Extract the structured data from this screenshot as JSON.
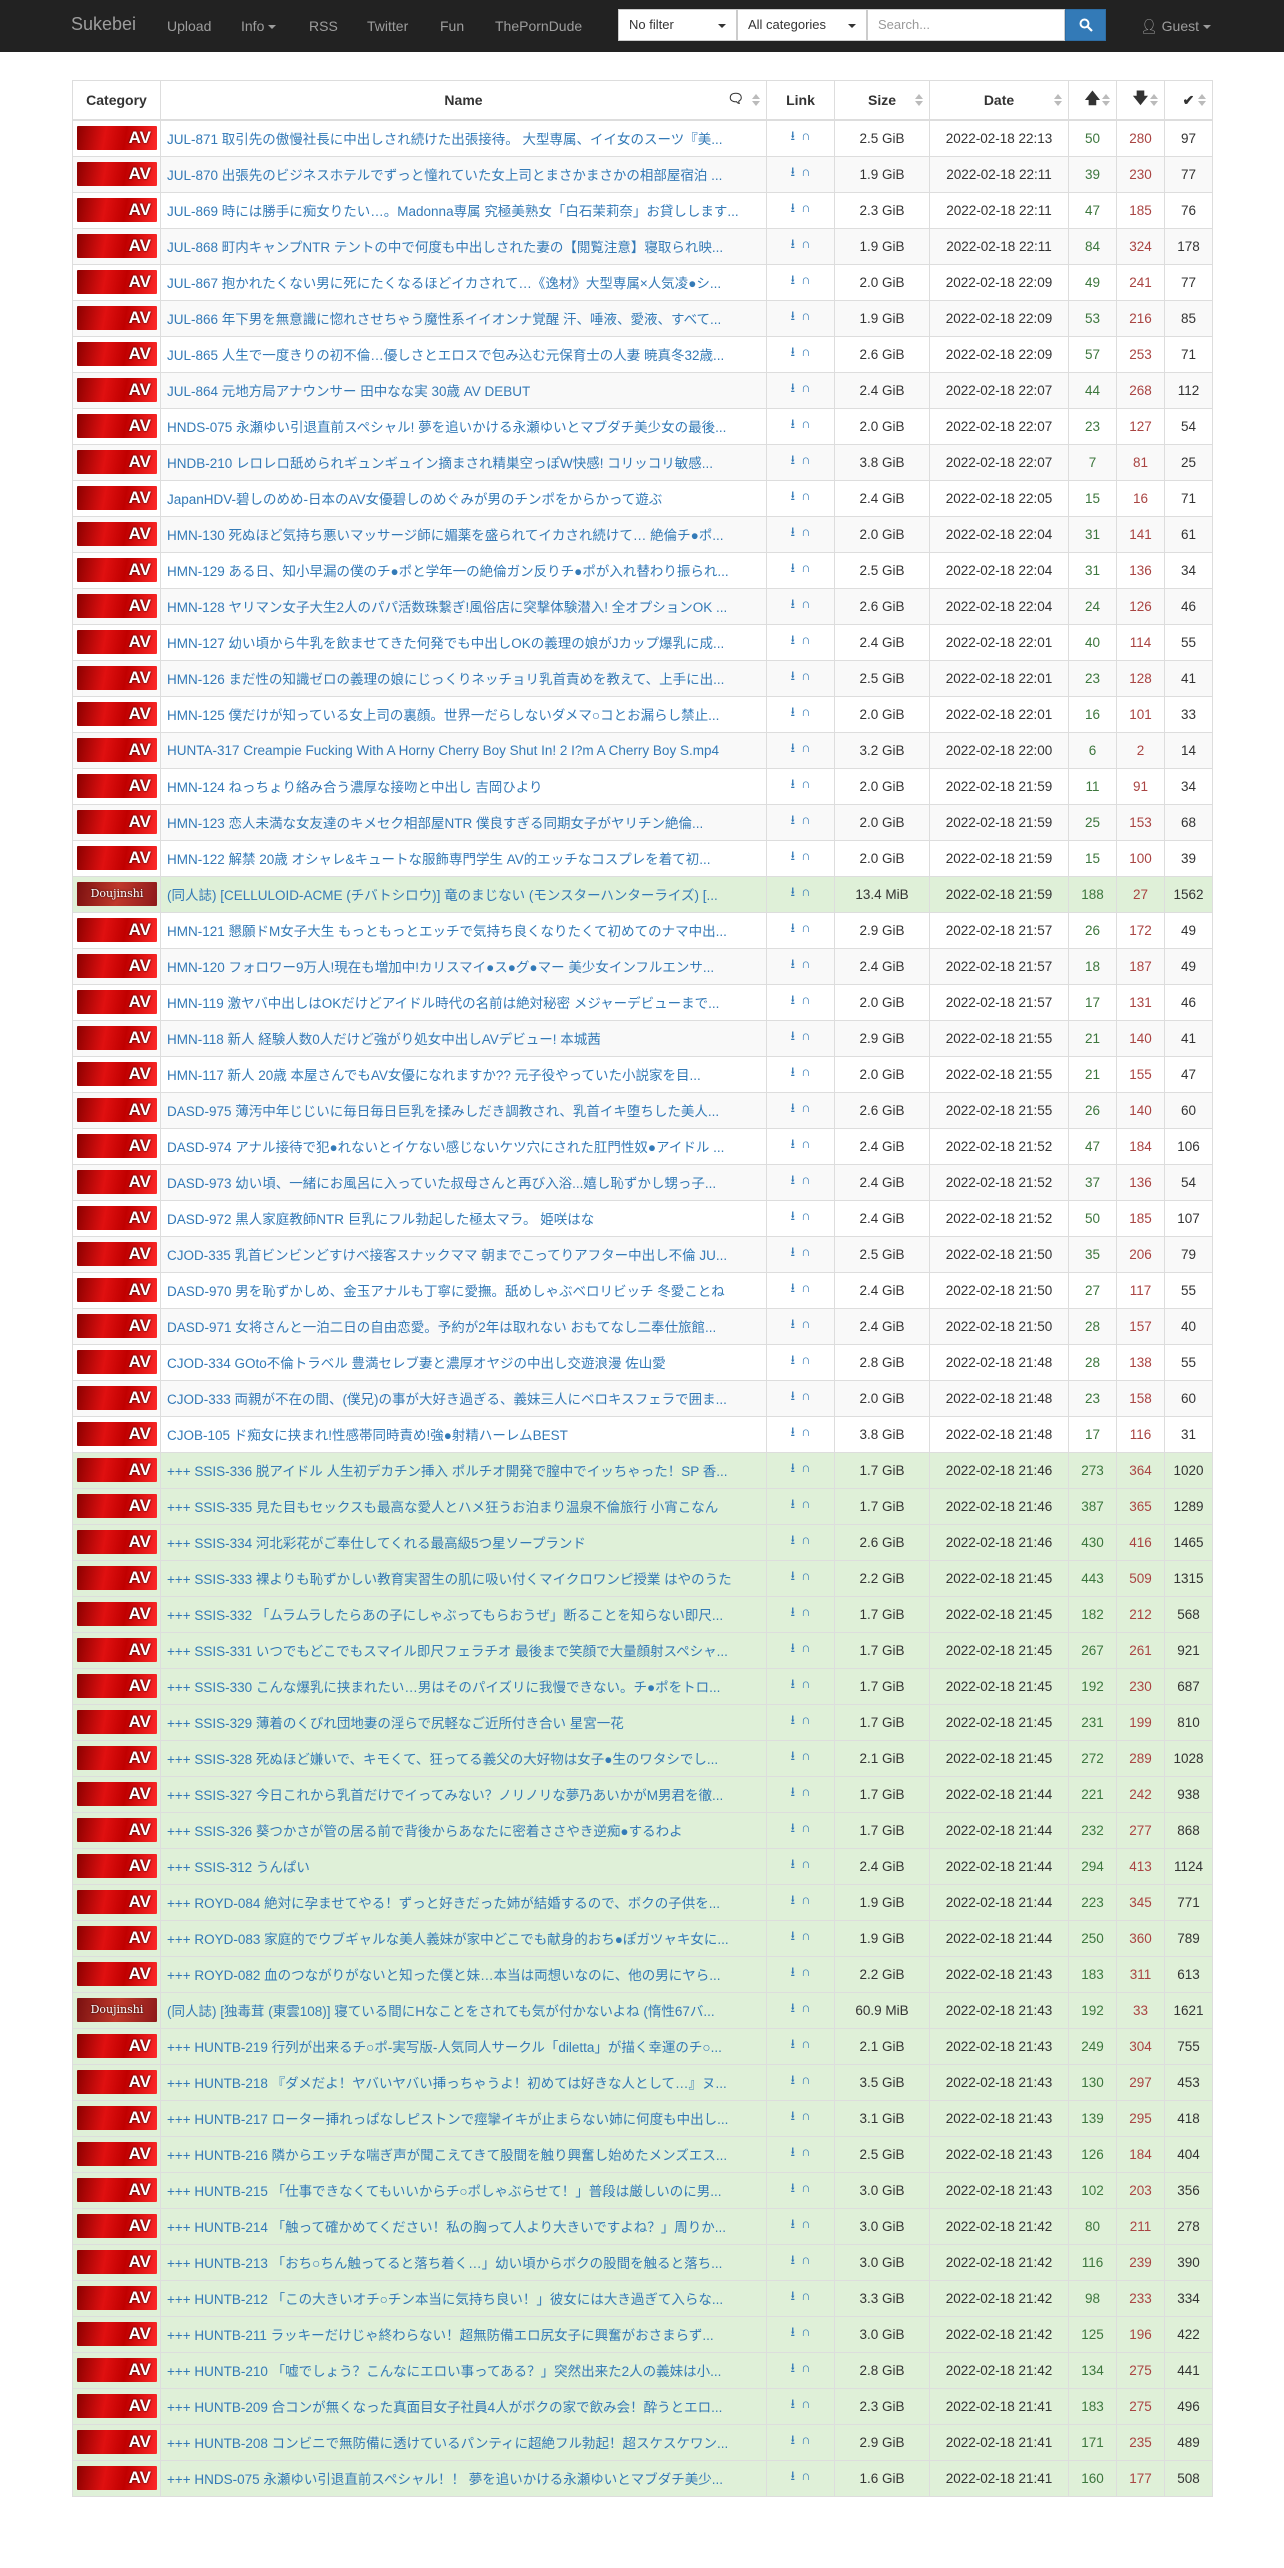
{
  "nav": {
    "brand": "Sukebei",
    "upload": "Upload",
    "info": "Info",
    "rss": "RSS",
    "twitter": "Twitter",
    "fun": "Fun",
    "porndude": "ThePornDude",
    "filter": "No filter",
    "categories": "All categories",
    "search_placeholder": "Search...",
    "guest": "Guest"
  },
  "table": {
    "headers": {
      "category": "Category",
      "name": "Name",
      "link": "Link",
      "size": "Size",
      "date": "Date"
    },
    "rows": [
      {
        "cat": "AV",
        "name": "JUL-871 取引先の傲慢社長に中出しされ続けた出張接待。 大型専属、イイ女のスーツ『美...",
        "size": "2.5 GiB",
        "date": "2022-02-18 22:13",
        "s": "50",
        "l": "280",
        "c": "97",
        "g": false
      },
      {
        "cat": "AV",
        "name": "JUL-870 出張先のビジネスホテルでずっと憧れていた女上司とまさかまさかの相部屋宿泊 ...",
        "size": "1.9 GiB",
        "date": "2022-02-18 22:11",
        "s": "39",
        "l": "230",
        "c": "77",
        "g": false
      },
      {
        "cat": "AV",
        "name": "JUL-869 時には勝手に痴女りたい…。Madonna専属 究極美熟女「白石茉莉奈」お貸しします...",
        "size": "2.3 GiB",
        "date": "2022-02-18 22:11",
        "s": "47",
        "l": "185",
        "c": "76",
        "g": false
      },
      {
        "cat": "AV",
        "name": "JUL-868 町内キャンプNTR テントの中で何度も中出しされた妻の【閲覧注意】寝取られ映...",
        "size": "1.9 GiB",
        "date": "2022-02-18 22:11",
        "s": "84",
        "l": "324",
        "c": "178",
        "g": false
      },
      {
        "cat": "AV",
        "name": "JUL-867 抱かれたくない男に死にたくなるほどイカされて…《逸材》大型専属×人気凌●シ...",
        "size": "2.0 GiB",
        "date": "2022-02-18 22:09",
        "s": "49",
        "l": "241",
        "c": "77",
        "g": false
      },
      {
        "cat": "AV",
        "name": "JUL-866 年下男を無意識に惚れさせちゃう魔性系イイオンナ覚醒 汗、唾液、愛液、すべて...",
        "size": "1.9 GiB",
        "date": "2022-02-18 22:09",
        "s": "53",
        "l": "216",
        "c": "85",
        "g": false
      },
      {
        "cat": "AV",
        "name": "JUL-865 人生で一度きりの初不倫…優しさとエロスで包み込む元保育士の人妻 暁真冬32歳...",
        "size": "2.6 GiB",
        "date": "2022-02-18 22:09",
        "s": "57",
        "l": "253",
        "c": "71",
        "g": false
      },
      {
        "cat": "AV",
        "name": "JUL-864 元地方局アナウンサー 田中なな実 30歳 AV DEBUT",
        "size": "2.4 GiB",
        "date": "2022-02-18 22:07",
        "s": "44",
        "l": "268",
        "c": "112",
        "g": false
      },
      {
        "cat": "AV",
        "name": "HNDS-075 永瀬ゆい引退直前スペシャル! 夢を追いかける永瀬ゆいとマブダチ美少女の最後...",
        "size": "2.0 GiB",
        "date": "2022-02-18 22:07",
        "s": "23",
        "l": "127",
        "c": "54",
        "g": false
      },
      {
        "cat": "AV",
        "name": "HNDB-210 レロレロ舐められギュンギュイン摘まされ精巣空っぽW快感! コリッコリ敏感...",
        "size": "3.8 GiB",
        "date": "2022-02-18 22:07",
        "s": "7",
        "l": "81",
        "c": "25",
        "g": false
      },
      {
        "cat": "AV",
        "name": "JapanHDV-碧しのめめ-日本のAV女優碧しのめぐみが男のチンポをからかって遊ぶ",
        "size": "2.4 GiB",
        "date": "2022-02-18 22:05",
        "s": "15",
        "l": "16",
        "c": "71",
        "g": false
      },
      {
        "cat": "AV",
        "name": "HMN-130 死ぬほど気持ち悪いマッサージ師に媚薬を盛られてイカされ続けて… 絶倫チ●ポ...",
        "size": "2.0 GiB",
        "date": "2022-02-18 22:04",
        "s": "31",
        "l": "141",
        "c": "61",
        "g": false
      },
      {
        "cat": "AV",
        "name": "HMN-129 ある日、知小早漏の僕のチ●ポと学年一の絶倫ガン反りチ●ポが入れ替わり振られ...",
        "size": "2.5 GiB",
        "date": "2022-02-18 22:04",
        "s": "31",
        "l": "136",
        "c": "34",
        "g": false
      },
      {
        "cat": "AV",
        "name": "HMN-128 ヤリマン女子大生2人のパパ活数珠繋ぎ!風俗店に突撃体験潜入! 全オプションOK ...",
        "size": "2.6 GiB",
        "date": "2022-02-18 22:04",
        "s": "24",
        "l": "126",
        "c": "46",
        "g": false
      },
      {
        "cat": "AV",
        "name": "HMN-127 幼い頃から牛乳を飲ませてきた何発でも中出しOKの義理の娘がJカップ爆乳に成...",
        "size": "2.4 GiB",
        "date": "2022-02-18 22:01",
        "s": "40",
        "l": "114",
        "c": "55",
        "g": false
      },
      {
        "cat": "AV",
        "name": "HMN-126 まだ性の知識ゼロの義理の娘にじっくりネッチョリ乳首責めを教えて、上手に出...",
        "size": "2.5 GiB",
        "date": "2022-02-18 22:01",
        "s": "23",
        "l": "128",
        "c": "41",
        "g": false
      },
      {
        "cat": "AV",
        "name": "HMN-125 僕だけが知っている女上司の裏顔。世界一だらしないダメマ○コとお漏らし禁止...",
        "size": "2.0 GiB",
        "date": "2022-02-18 22:01",
        "s": "16",
        "l": "101",
        "c": "33",
        "g": false
      },
      {
        "cat": "AV",
        "name": "HUNTA-317 Creampie Fucking With A Horny Cherry Boy Shut In! 2 I?m A Cherry Boy S.mp4",
        "size": "3.2 GiB",
        "date": "2022-02-18 22:00",
        "s": "6",
        "l": "2",
        "c": "14",
        "g": false
      },
      {
        "cat": "AV",
        "name": "HMN-124 ねっちょり絡み合う濃厚な接吻と中出し 吉岡ひより",
        "size": "2.0 GiB",
        "date": "2022-02-18 21:59",
        "s": "11",
        "l": "91",
        "c": "34",
        "g": false
      },
      {
        "cat": "AV",
        "name": "HMN-123 恋人未満な女友達のキメセク相部屋NTR 僕良すぎる同期女子がヤリチン絶倫...",
        "size": "2.0 GiB",
        "date": "2022-02-18 21:59",
        "s": "25",
        "l": "153",
        "c": "68",
        "g": false
      },
      {
        "cat": "AV",
        "name": "HMN-122 解禁 20歳 オシャレ&キュートな服飾専門学生 AV的エッチなコスプレを着て初...",
        "size": "2.0 GiB",
        "date": "2022-02-18 21:59",
        "s": "15",
        "l": "100",
        "c": "39",
        "g": false
      },
      {
        "cat": "DJ",
        "name": "(同人誌) [CELLULOID-ACME (チバトシロウ)] 竜のまじない (モンスターハンターライズ) [...",
        "size": "13.4 MiB",
        "date": "2022-02-18 21:59",
        "s": "188",
        "l": "27",
        "c": "1562",
        "g": true
      },
      {
        "cat": "AV",
        "name": "HMN-121 懇願ドM女子大生 もっともっとエッチで気持ち良くなりたくて初めてのナマ中出...",
        "size": "2.9 GiB",
        "date": "2022-02-18 21:57",
        "s": "26",
        "l": "172",
        "c": "49",
        "g": false
      },
      {
        "cat": "AV",
        "name": "HMN-120 フォロワー9万人!現在も増加中!カリスマイ●ス●グ●マー 美少女インフルエンサ...",
        "size": "2.4 GiB",
        "date": "2022-02-18 21:57",
        "s": "18",
        "l": "187",
        "c": "49",
        "g": false
      },
      {
        "cat": "AV",
        "name": "HMN-119 激ヤバ中出しはOKだけどアイドル時代の名前は絶対秘密 メジャーデビューまで...",
        "size": "2.0 GiB",
        "date": "2022-02-18 21:57",
        "s": "17",
        "l": "131",
        "c": "46",
        "g": false
      },
      {
        "cat": "AV",
        "name": "HMN-118 新人 経験人数0人だけど強がり処女中出しAVデビュー! 本城茜",
        "size": "2.9 GiB",
        "date": "2022-02-18 21:55",
        "s": "21",
        "l": "140",
        "c": "41",
        "g": false
      },
      {
        "cat": "AV",
        "name": "HMN-117 新人 20歳 本屋さんでもAV女優になれますか?? 元子役やっていた小説家を目...",
        "size": "2.0 GiB",
        "date": "2022-02-18 21:55",
        "s": "21",
        "l": "155",
        "c": "47",
        "g": false
      },
      {
        "cat": "AV",
        "name": "DASD-975 薄汚中年じじいに毎日毎日巨乳を揉みしだき調教され、乳首イキ堕ちした美人...",
        "size": "2.6 GiB",
        "date": "2022-02-18 21:55",
        "s": "26",
        "l": "140",
        "c": "60",
        "g": false
      },
      {
        "cat": "AV",
        "name": "DASD-974 アナル接待で犯●れないとイケない感じないケツ穴にされた肛門性奴●アイドル ...",
        "size": "2.4 GiB",
        "date": "2022-02-18 21:52",
        "s": "47",
        "l": "184",
        "c": "106",
        "g": false
      },
      {
        "cat": "AV",
        "name": "DASD-973 幼い頃、一緒にお風呂に入っていた叔母さんと再び入浴...嬉し恥ずかし甥っ子...",
        "size": "2.4 GiB",
        "date": "2022-02-18 21:52",
        "s": "37",
        "l": "136",
        "c": "54",
        "g": false
      },
      {
        "cat": "AV",
        "name": "DASD-972 黒人家庭教師NTR 巨乳にフル勃起した極太マラ。 姫咲はな",
        "size": "2.4 GiB",
        "date": "2022-02-18 21:52",
        "s": "50",
        "l": "185",
        "c": "107",
        "g": false
      },
      {
        "cat": "AV",
        "name": "CJOD-335 乳首ビンビンどすけべ接客スナックママ 朝までこってりアフター中出し不倫 JU...",
        "size": "2.5 GiB",
        "date": "2022-02-18 21:50",
        "s": "35",
        "l": "206",
        "c": "79",
        "g": false
      },
      {
        "cat": "AV",
        "name": "DASD-970 男を恥ずかしめ、金玉アナルも丁寧に愛撫。舐めしゃぶベロリビッチ 冬愛ことね",
        "size": "2.4 GiB",
        "date": "2022-02-18 21:50",
        "s": "27",
        "l": "117",
        "c": "55",
        "g": false
      },
      {
        "cat": "AV",
        "name": "DASD-971 女将さんと一泊二日の自由恋愛。予約が2年は取れない おもてなし二奉仕旅館...",
        "size": "2.4 GiB",
        "date": "2022-02-18 21:50",
        "s": "28",
        "l": "157",
        "c": "40",
        "g": false
      },
      {
        "cat": "AV",
        "name": "CJOD-334 GOto不倫トラベル 豊満セレブ妻と濃厚オヤジの中出し交遊浪漫 佐山愛",
        "size": "2.8 GiB",
        "date": "2022-02-18 21:48",
        "s": "28",
        "l": "138",
        "c": "55",
        "g": false
      },
      {
        "cat": "AV",
        "name": "CJOD-333 両親が不在の間、(僕兄)の事が大好き過ぎる、義妹三人にベロキスフェラで囲ま...",
        "size": "2.0 GiB",
        "date": "2022-02-18 21:48",
        "s": "23",
        "l": "158",
        "c": "60",
        "g": false
      },
      {
        "cat": "AV",
        "name": "CJOB-105 ド痴女に挟まれ!性感帯同時責め!強●射精ハーレムBEST",
        "size": "3.8 GiB",
        "date": "2022-02-18 21:48",
        "s": "17",
        "l": "116",
        "c": "31",
        "g": false
      },
      {
        "cat": "AV",
        "name": "+++ SSIS-336 脱アイドル 人生初デカチン挿入 ポルチオ開発で膣中でイッちゃった！SP 香...",
        "size": "1.7 GiB",
        "date": "2022-02-18 21:46",
        "s": "273",
        "l": "364",
        "c": "1020",
        "g": true
      },
      {
        "cat": "AV",
        "name": "+++ SSIS-335 見た目もセックスも最高な愛人とハメ狂うお泊まり温泉不倫旅行 小宵こなん",
        "size": "1.7 GiB",
        "date": "2022-02-18 21:46",
        "s": "387",
        "l": "365",
        "c": "1289",
        "g": true
      },
      {
        "cat": "AV",
        "name": "+++ SSIS-334 河北彩花がご奉仕してくれる最高級5つ星ソープランド",
        "size": "2.6 GiB",
        "date": "2022-02-18 21:46",
        "s": "430",
        "l": "416",
        "c": "1465",
        "g": true
      },
      {
        "cat": "AV",
        "name": "+++ SSIS-333 裸よりも恥ずかしい教育実習生の肌に吸い付くマイクロワンピ授業 はやのうた",
        "size": "2.2 GiB",
        "date": "2022-02-18 21:45",
        "s": "443",
        "l": "509",
        "c": "1315",
        "g": true
      },
      {
        "cat": "AV",
        "name": "+++ SSIS-332 「ムラムラしたらあの子にしゃぶってもらおうぜ」断ることを知らない即尺...",
        "size": "1.7 GiB",
        "date": "2022-02-18 21:45",
        "s": "182",
        "l": "212",
        "c": "568",
        "g": true
      },
      {
        "cat": "AV",
        "name": "+++ SSIS-331 いつでもどこでもスマイル即尺フェラチオ 最後まで笑顔で大量顔射スペシャ...",
        "size": "1.7 GiB",
        "date": "2022-02-18 21:45",
        "s": "267",
        "l": "261",
        "c": "921",
        "g": true
      },
      {
        "cat": "AV",
        "name": "+++ SSIS-330 こんな爆乳に挟まれたい…男はそのパイズリに我慢できない。チ●ポをトロ...",
        "size": "1.7 GiB",
        "date": "2022-02-18 21:45",
        "s": "192",
        "l": "230",
        "c": "687",
        "g": true
      },
      {
        "cat": "AV",
        "name": "+++ SSIS-329 薄着のくびれ団地妻の淫らで尻軽なご近所付き合い 星宮一花",
        "size": "1.7 GiB",
        "date": "2022-02-18 21:45",
        "s": "231",
        "l": "199",
        "c": "810",
        "g": true
      },
      {
        "cat": "AV",
        "name": "+++ SSIS-328 死ぬほど嫌いで、キモくて、狂ってる義父の大好物は女子●生のワタシでし...",
        "size": "2.1 GiB",
        "date": "2022-02-18 21:45",
        "s": "272",
        "l": "289",
        "c": "1028",
        "g": true
      },
      {
        "cat": "AV",
        "name": "+++ SSIS-327 今日これから乳首だけでイってみない？ノリノリな夢乃あいかがM男君を徹...",
        "size": "1.7 GiB",
        "date": "2022-02-18 21:44",
        "s": "221",
        "l": "242",
        "c": "938",
        "g": true
      },
      {
        "cat": "AV",
        "name": "+++ SSIS-326 葵つかさが管の居る前で背後からあなたに密着ささやき逆痴●するわよ",
        "size": "1.7 GiB",
        "date": "2022-02-18 21:44",
        "s": "232",
        "l": "277",
        "c": "868",
        "g": true
      },
      {
        "cat": "AV",
        "name": "+++ SSIS-312 うんぱい",
        "size": "2.4 GiB",
        "date": "2022-02-18 21:44",
        "s": "294",
        "l": "413",
        "c": "1124",
        "g": true
      },
      {
        "cat": "AV",
        "name": "+++ ROYD-084 絶対に孕ませてやる！ずっと好きだった姉が結婚するので、ボクの子供を...",
        "size": "1.9 GiB",
        "date": "2022-02-18 21:44",
        "s": "223",
        "l": "345",
        "c": "771",
        "g": true
      },
      {
        "cat": "AV",
        "name": "+++ ROYD-083 家庭的でウブギャルな美人義妹が家中どこでも献身的おち●ぽガツャキ女に...",
        "size": "1.9 GiB",
        "date": "2022-02-18 21:44",
        "s": "250",
        "l": "360",
        "c": "789",
        "g": true
      },
      {
        "cat": "AV",
        "name": "+++ ROYD-082 血のつながりがないと知った僕と妹…本当は両想いなのに、他の男にヤら...",
        "size": "2.2 GiB",
        "date": "2022-02-18 21:43",
        "s": "183",
        "l": "311",
        "c": "613",
        "g": true
      },
      {
        "cat": "DJ",
        "name": "(同人誌) [独毒茸 (東雲108)] 寝ている間にHなことをされても気が付かないよね (惰性67バ...",
        "size": "60.9 MiB",
        "date": "2022-02-18 21:43",
        "s": "192",
        "l": "33",
        "c": "1621",
        "g": true
      },
      {
        "cat": "AV",
        "name": "+++ HUNTB-219 行列が出来るチ○ポ-実写版-人気同人サークル「diletta」が描く幸運のチ○...",
        "size": "2.1 GiB",
        "date": "2022-02-18 21:43",
        "s": "249",
        "l": "304",
        "c": "755",
        "g": true
      },
      {
        "cat": "AV",
        "name": "+++ HUNTB-218 『ダメだよ！ヤバいヤバい挿っちゃうよ！初めては好きな人として…』ヌ...",
        "size": "3.5 GiB",
        "date": "2022-02-18 21:43",
        "s": "130",
        "l": "297",
        "c": "453",
        "g": true
      },
      {
        "cat": "AV",
        "name": "+++ HUNTB-217 ローター挿れっぱなしピストンで痙攣イキが止まらない姉に何度も中出し...",
        "size": "3.1 GiB",
        "date": "2022-02-18 21:43",
        "s": "139",
        "l": "295",
        "c": "418",
        "g": true
      },
      {
        "cat": "AV",
        "name": "+++ HUNTB-216 隣からエッチな喘ぎ声が聞こえてきて股間を触り興奮し始めたメンズエス...",
        "size": "2.5 GiB",
        "date": "2022-02-18 21:43",
        "s": "126",
        "l": "184",
        "c": "404",
        "g": true
      },
      {
        "cat": "AV",
        "name": "+++ HUNTB-215 「仕事できなくてもいいからチ○ポしゃぶらせて！」普段は厳しいのに男...",
        "size": "3.0 GiB",
        "date": "2022-02-18 21:43",
        "s": "102",
        "l": "203",
        "c": "356",
        "g": true
      },
      {
        "cat": "AV",
        "name": "+++ HUNTB-214 「触って確かめてください！私の胸って人より大きいですよね？」周りか...",
        "size": "3.0 GiB",
        "date": "2022-02-18 21:42",
        "s": "80",
        "l": "211",
        "c": "278",
        "g": true
      },
      {
        "cat": "AV",
        "name": "+++ HUNTB-213 「おち○ちん触ってると落ち着く…」幼い頃からボクの股間を触ると落ち...",
        "size": "3.0 GiB",
        "date": "2022-02-18 21:42",
        "s": "116",
        "l": "239",
        "c": "390",
        "g": true
      },
      {
        "cat": "AV",
        "name": "+++ HUNTB-212 「この大きいオチ○チン本当に気持ち良い！」彼女には大き過ぎて入らな...",
        "size": "3.3 GiB",
        "date": "2022-02-18 21:42",
        "s": "98",
        "l": "233",
        "c": "334",
        "g": true
      },
      {
        "cat": "AV",
        "name": "+++ HUNTB-211 ラッキーだけじゃ終わらない！超無防備エロ尻女子に興奮がおさまらず...",
        "size": "3.0 GiB",
        "date": "2022-02-18 21:42",
        "s": "125",
        "l": "196",
        "c": "422",
        "g": true
      },
      {
        "cat": "AV",
        "name": "+++ HUNTB-210 「嘘でしょう？こんなにエロい事ってある？」突然出来た2人の義妹は小...",
        "size": "2.8 GiB",
        "date": "2022-02-18 21:42",
        "s": "134",
        "l": "275",
        "c": "441",
        "g": true
      },
      {
        "cat": "AV",
        "name": "+++ HUNTB-209 合コンが無くなった真面目女子社員4人がボクの家で飲み会！酔うとエロ...",
        "size": "2.3 GiB",
        "date": "2022-02-18 21:41",
        "s": "183",
        "l": "275",
        "c": "496",
        "g": true
      },
      {
        "cat": "AV",
        "name": "+++ HUNTB-208 コンビニで無防備に透けているパンティに超絶フル勃起！超スケスケワン...",
        "size": "2.9 GiB",
        "date": "2022-02-18 21:41",
        "s": "171",
        "l": "235",
        "c": "489",
        "g": true
      },
      {
        "cat": "AV",
        "name": "+++ HNDS-075 永瀬ゆい引退直前スペシャル！！ 夢を追いかける永瀬ゆいとマブダチ美少...",
        "size": "1.6 GiB",
        "date": "2022-02-18 21:41",
        "s": "160",
        "l": "177",
        "c": "508",
        "g": true
      }
    ]
  }
}
